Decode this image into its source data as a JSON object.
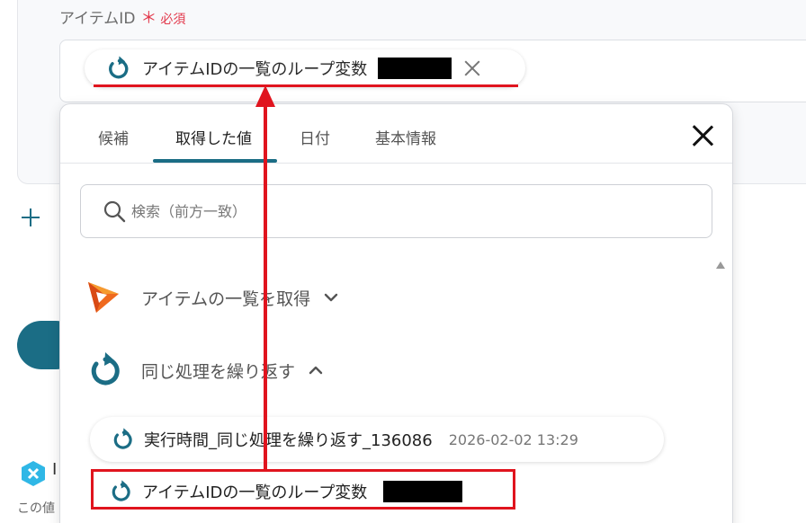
{
  "field": {
    "label": "アイテムID",
    "required_mark": "＊",
    "required_text": "必須",
    "chip_text": "アイテムIDの一覧のループ変数"
  },
  "popup": {
    "tabs": [
      {
        "label": "候補"
      },
      {
        "label": "取得した値"
      },
      {
        "label": "日付"
      },
      {
        "label": "基本情報"
      }
    ],
    "active_tab": "取得した値",
    "search_placeholder": "検索（前方一致）",
    "sections": [
      {
        "title": "アイテムの一覧を取得",
        "expanded": false
      },
      {
        "title": "同じ処理を繰り返す",
        "expanded": true
      }
    ],
    "items": [
      {
        "label": "実行時間_同じ処理を繰り返す_136086",
        "meta": "2026-02-02 13:29"
      },
      {
        "label": "アイテムIDの一覧のループ変数"
      }
    ]
  },
  "background": {
    "note": "この値"
  },
  "colors": {
    "accent": "#1b6d85",
    "annotation_red": "#e0141e",
    "required_red": "#e2384b"
  },
  "icons": {
    "loop": "loop-arrow-icon",
    "app": "orange-play-logo-icon",
    "search": "search-icon",
    "close": "close-icon"
  }
}
